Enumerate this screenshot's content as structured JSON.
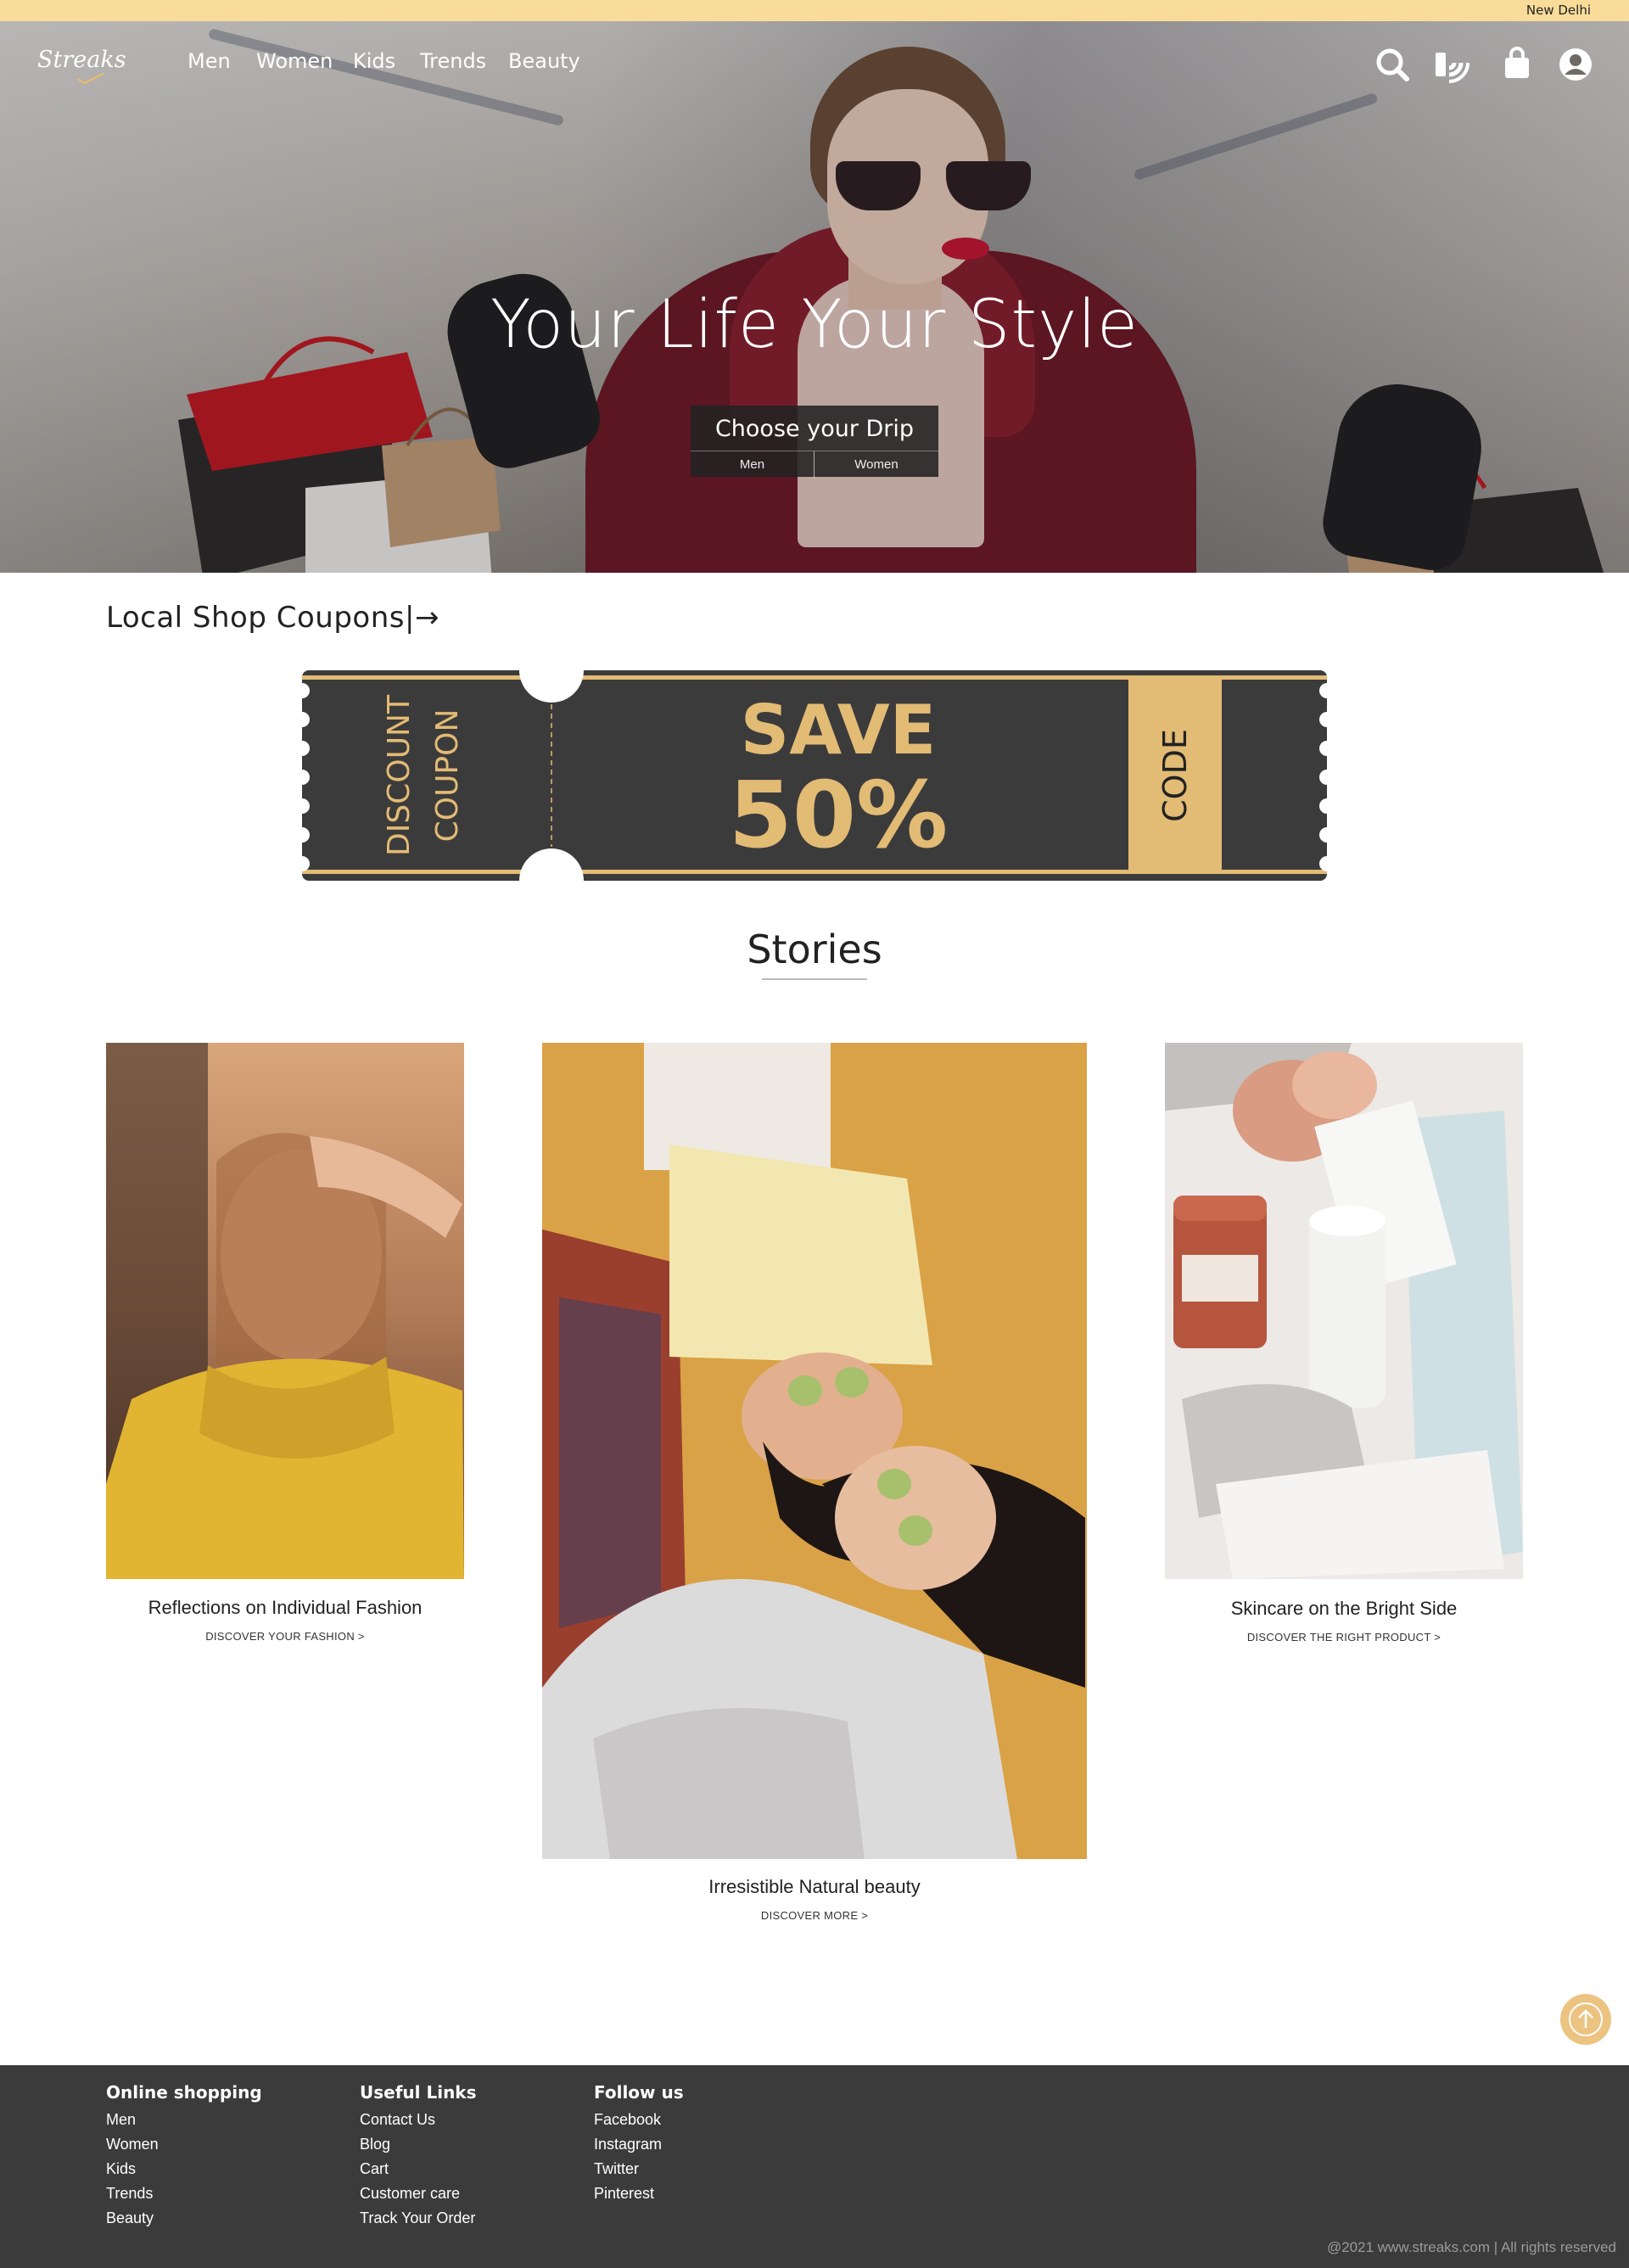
{
  "topbar": {
    "location": "New Delhi"
  },
  "nav": {
    "logo": "Streaks",
    "menu": [
      "Men",
      "Women",
      "Kids",
      "Trends",
      "Beauty"
    ],
    "icons": [
      "search-icon",
      "blog-icon",
      "shopping-bag-icon",
      "user-account-icon"
    ]
  },
  "hero": {
    "title": "Your Life Your Style",
    "drip_label": "Choose your Drip",
    "drip_men": "Men",
    "drip_women": "Women"
  },
  "coupons": {
    "heading": "Local Shop Coupons|→",
    "left_line1": "DISCOUNT",
    "left_line2": "COUPON",
    "save": "SAVE",
    "percent": "50%",
    "code": "CODE",
    "colors": {
      "ticket": "#3c3b3c",
      "gold": "#e2bb74"
    }
  },
  "stories": {
    "title": "Stories",
    "items": [
      {
        "caption": "Reflections on Individual Fashion",
        "link": "DISCOVER YOUR FASHION >"
      },
      {
        "caption": "Irresistible Natural beauty",
        "link": "DISCOVER MORE >"
      },
      {
        "caption": "Skincare on the Bright Side",
        "link": "DISCOVER THE RIGHT PRODUCT >"
      }
    ]
  },
  "footer": {
    "columns": [
      {
        "heading": "Online shopping",
        "links": [
          "Men",
          "Women",
          "Kids",
          "Trends",
          "Beauty"
        ]
      },
      {
        "heading": "Useful Links",
        "links": [
          "Contact Us",
          "Blog",
          "Cart",
          "Customer care",
          "Track Your Order"
        ]
      },
      {
        "heading": "Follow us",
        "links": [
          "Facebook",
          "Instagram",
          "Twitter",
          "Pinterest"
        ]
      }
    ],
    "copyright": "@2021 www.streaks.com | All rights reserved"
  },
  "colors": {
    "topbar": "#f9dc9a",
    "footer": "#3b3b3c",
    "accent": "#ecc381"
  }
}
